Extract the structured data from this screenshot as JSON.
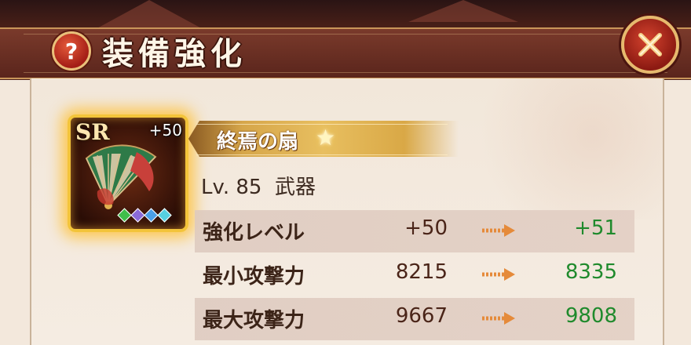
{
  "header": {
    "title": "装備強化",
    "help_icon": "question-mark-icon",
    "close_icon": "close-x-icon",
    "help_glyph": "?"
  },
  "item": {
    "rarity": "SR",
    "enhance": "+50",
    "name": "終焉の扇",
    "star": "★",
    "level": "Lv. 85",
    "type": "武器",
    "gem_colors": [
      "#3fbf4a",
      "#8a6ad8",
      "#4aa0e8",
      "#56d0e0"
    ]
  },
  "stats": [
    {
      "label": "強化レベル",
      "current": "+50",
      "next": "+51"
    },
    {
      "label": "最小攻撃力",
      "current": "8215",
      "next": "8335"
    },
    {
      "label": "最大攻撃力",
      "current": "9667",
      "next": "9808"
    }
  ],
  "colors": {
    "increase": "#1f8a2c",
    "arrow": "#e58a3a",
    "card_border": "#f3c43a"
  }
}
